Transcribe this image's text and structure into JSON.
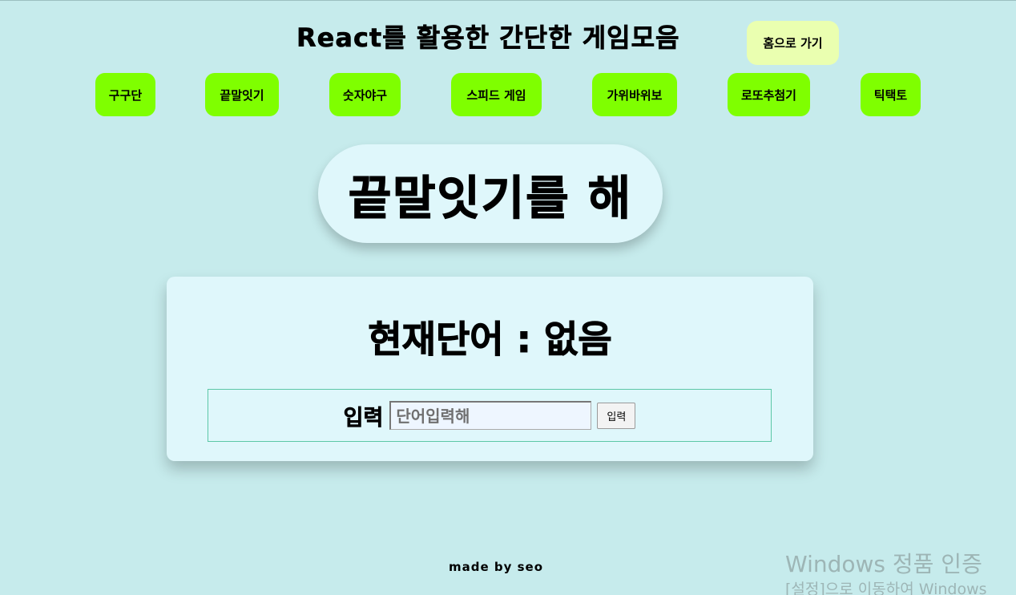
{
  "header": {
    "title": "React를 활용한 간단한 게임모음",
    "home_label": "홈으로 가기"
  },
  "nav": {
    "items": [
      {
        "label": "구구단"
      },
      {
        "label": "끝말잇기"
      },
      {
        "label": "숫자야구"
      },
      {
        "label": "스피드 게임"
      },
      {
        "label": "가위바위보"
      },
      {
        "label": "로또추첨기"
      },
      {
        "label": "틱택토"
      }
    ]
  },
  "game": {
    "heading": "끝말잇기를 해",
    "current_word": "현재단어 : 없음",
    "input_label": "입력",
    "input_placeholder": "단어입력해",
    "input_value": "",
    "submit_label": "입력"
  },
  "footer": {
    "text": "made by seo"
  },
  "watermark": {
    "title": "Windows 정품 인증",
    "subtitle": "[설정]으로 이동하여 Windows"
  },
  "colors": {
    "background": "#c6ebec",
    "nav_button": "#7fff00",
    "home_button": "#eaffb0",
    "panel": "#dff7fb",
    "form_border": "#5cc7a6"
  }
}
